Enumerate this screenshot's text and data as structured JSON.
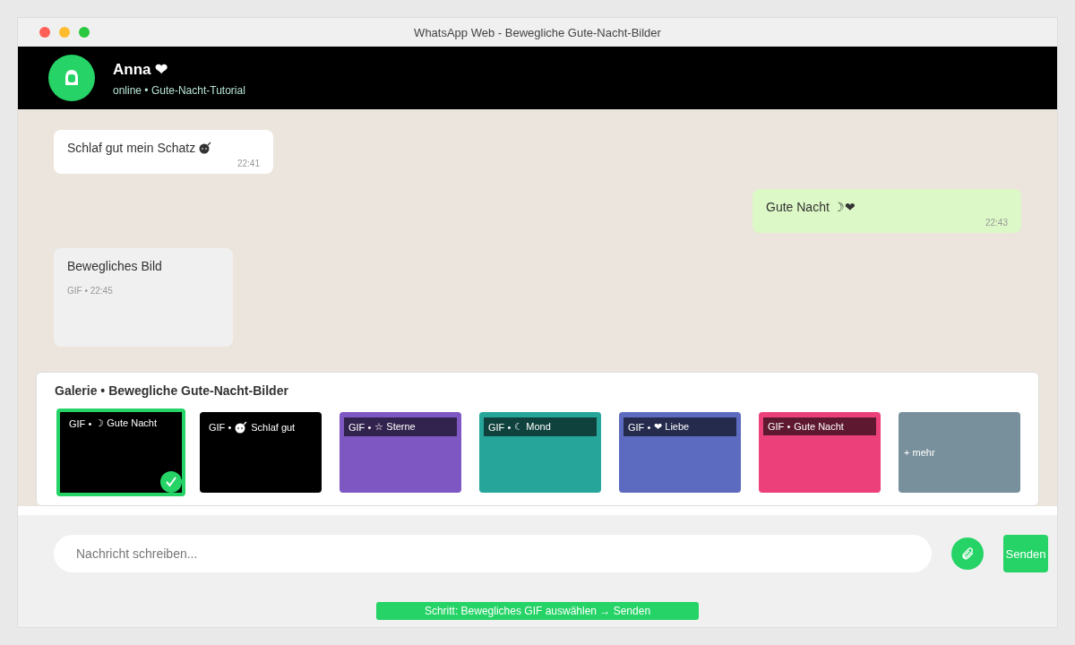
{
  "window": {
    "title": "WhatsApp Web - Bewegliche Gute-Nacht-Bilder"
  },
  "header": {
    "name": "Anna ❤",
    "status": "online • Gute-Nacht-Tutorial"
  },
  "messages": [
    {
      "kind": "in",
      "text": "Schlaf gut mein Schatz",
      "time": "22:41"
    },
    {
      "kind": "out",
      "text": "Gute Nacht ☽❤",
      "time": "22:43"
    },
    {
      "kind": "media",
      "text": "Bewegliches Bild",
      "time": "GIF • 22:45"
    }
  ],
  "gallery": {
    "title": "Galerie • Bewegliche Gute-Nacht-Bilder",
    "items": [
      {
        "kind": "gif",
        "tag": "GIF •",
        "label": "☽ Gute Nacht",
        "color": "#000000",
        "selected": true
      },
      {
        "kind": "gif",
        "tag": "GIF •",
        "label": "Schlaf gut",
        "color": "#000000",
        "selected": false
      },
      {
        "kind": "gif",
        "tag": "GIF •",
        "label": "☆ Sterne",
        "color": "#7e57c2",
        "selected": false
      },
      {
        "kind": "gif",
        "tag": "GIF •",
        "label": "☾ Mond",
        "color": "#26a69a",
        "selected": false
      },
      {
        "kind": "gif",
        "tag": "GIF •",
        "label": "❤  Liebe",
        "color": "#5c6bc0",
        "selected": false
      },
      {
        "kind": "gif",
        "tag": "GIF •",
        "label": "Gute Nacht",
        "color": "#ec407a",
        "selected": false
      },
      {
        "kind": "more",
        "label": "+ mehr",
        "color": "#78909c",
        "selected": false
      }
    ]
  },
  "composer": {
    "placeholder": "Nachricht schreiben...",
    "send": "Senden"
  },
  "hint": "Schritt: Bewegliches GIF auswählen → Senden"
}
